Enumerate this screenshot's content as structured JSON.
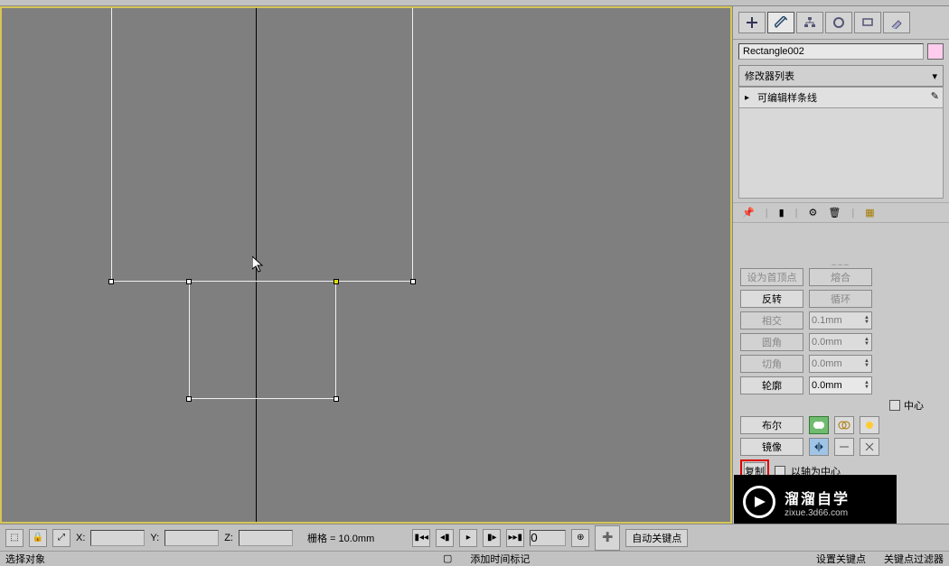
{
  "object_name": "Rectangle002",
  "modifier_list_label": "修改器列表",
  "modifier_item": "可编辑样条线",
  "params": {
    "first_vertex": "设为首顶点",
    "weld": "熔合",
    "reverse": "反转",
    "cycle": "循环",
    "intersect": "相交",
    "intersect_val": "0.1mm",
    "fillet": "圆角",
    "fillet_val": "0.0mm",
    "chamfer": "切角",
    "chamfer_val": "0.0mm",
    "outline": "轮廓",
    "outline_val": "0.0mm",
    "center": "中心",
    "boolean": "布尔",
    "mirror": "镜像",
    "copy": "复制",
    "about_pivot": "以轴为中心"
  },
  "timeline": {
    "x_label": "X:",
    "y_label": "Y:",
    "z_label": "Z:",
    "grid_label": "栅格 = 10.0mm",
    "frame": "0",
    "auto_key": "自动关键点",
    "set_key": "设置关键点",
    "key_filters": "关键点过滤器",
    "add_time_tag": "添加时间标记"
  },
  "status": {
    "select_object": "选择对象"
  },
  "watermark": {
    "cn": "溜溜自学",
    "en": "zixue.3d66.com"
  }
}
